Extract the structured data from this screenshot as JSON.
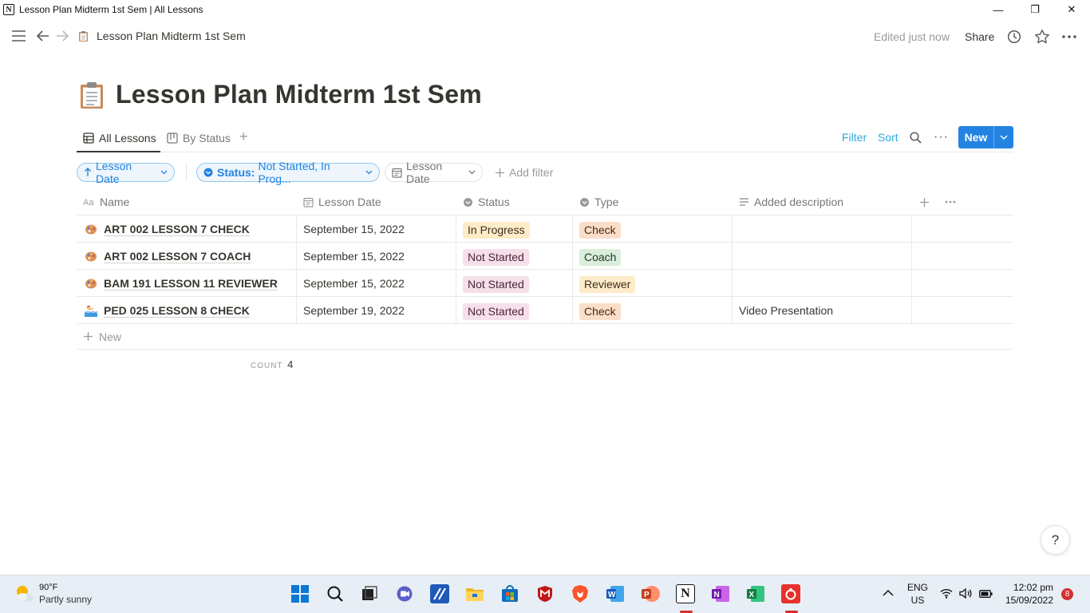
{
  "window": {
    "title": "Lesson Plan Midterm 1st Sem | All Lessons",
    "minimize": "—",
    "maximize": "❐",
    "close": "✕"
  },
  "topbar": {
    "breadcrumb": "Lesson Plan Midterm 1st Sem",
    "edited": "Edited just now",
    "share": "Share"
  },
  "page": {
    "title": "Lesson Plan Midterm 1st Sem",
    "icon": "clipboard-icon"
  },
  "views": {
    "tabs": [
      {
        "label": "All Lessons",
        "active": true
      },
      {
        "label": "By Status",
        "active": false
      }
    ],
    "add": "+"
  },
  "actions": {
    "filter": "Filter",
    "sort": "Sort",
    "more": "···",
    "new": "New"
  },
  "filters": {
    "sort_pill": "Lesson Date",
    "status_label": "Status:",
    "status_value": "Not Started, In Prog...",
    "date_pill": "Lesson Date",
    "add_filter": "Add filter"
  },
  "table": {
    "columns": {
      "name": "Name",
      "date": "Lesson Date",
      "status": "Status",
      "type": "Type",
      "desc": "Added description"
    },
    "rows": [
      {
        "name": "ART 002 LESSON 7 CHECK",
        "date": "September 15, 2022",
        "status": "In Progress",
        "type": "Check",
        "desc": "",
        "icon": "art-palette-icon"
      },
      {
        "name": "ART 002 LESSON 7 COACH",
        "date": "September 15, 2022",
        "status": "Not Started",
        "type": "Coach",
        "desc": "",
        "icon": "art-palette-icon"
      },
      {
        "name": "BAM 191 LESSON 11 REVIEWER",
        "date": "September 15, 2022",
        "status": "Not Started",
        "type": "Reviewer",
        "desc": "",
        "icon": "art-palette-icon"
      },
      {
        "name": "PED 025 LESSON 8 CHECK",
        "date": "September 19, 2022",
        "status": "Not Started",
        "type": "Check",
        "desc": "Video Presentation",
        "icon": "swimmer-icon"
      }
    ],
    "new_row": "New",
    "count_label": "COUNT",
    "count_value": "4"
  },
  "colors": {
    "status": {
      "In Progress": "#fdecc8",
      "Not Started": "#f5e0e9"
    },
    "status_text": {
      "In Progress": "#402c1b",
      "Not Started": "#4c2337"
    },
    "type": {
      "Check": "#fadec9",
      "Coach": "#dbeddb",
      "Reviewer": "#fdecc8"
    },
    "type_text": {
      "Check": "#49290e",
      "Coach": "#1c3829",
      "Reviewer": "#402c1b"
    },
    "accent": "#2383e2",
    "link": "#2eaadc"
  },
  "help": "?",
  "taskbar": {
    "temp": "90°F",
    "weather": "Partly sunny",
    "lang": "ENG",
    "region": "US",
    "time": "12:02 pm",
    "date": "15/09/2022",
    "badge": "8"
  }
}
